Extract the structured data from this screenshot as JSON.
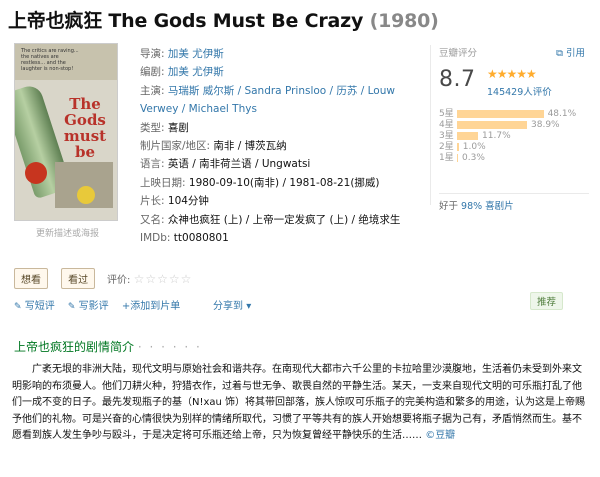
{
  "title": {
    "main": "上帝也疯狂 The Gods Must Be Crazy",
    "year": "(1980)"
  },
  "poster": {
    "tagline": "The critics are raving... the natives are restless... and the laughter is non-stop!",
    "title_text": "The Gods must be crazy",
    "more_desc": "更新描述或海报"
  },
  "info": {
    "director_label": "导演:",
    "director": "加美 尤伊斯",
    "writer_label": "编剧:",
    "writer": "加美 尤伊斯",
    "cast_label": "主演:",
    "cast_line1": "马瑞斯 威尔斯 / Sandra Prinsloo / 历苏 / Louw",
    "cast_line2": "Verwey / Michael Thys",
    "genre_label": "类型:",
    "genre": "喜剧",
    "country_label": "制片国家/地区:",
    "country": "南非 / 博茨瓦纳",
    "language_label": "语言:",
    "language": "英语 / 南非荷兰语 / Ungwatsi",
    "release_label": "上映日期:",
    "release": "1980-09-10(南非) / 1981-08-21(挪威)",
    "runtime_label": "片长:",
    "runtime": "104分钟",
    "aka_label": "又名:",
    "aka": "众神也疯狂 (上) / 上帝一定发疯了 (上) / 绝境求生",
    "imdb_label": "IMDb:",
    "imdb": "tt0080801"
  },
  "rating": {
    "header": "豆瓣评分",
    "cite": "引用",
    "score": "8.7",
    "stars": "★★★★★",
    "votes": "145429人评价",
    "distribution": [
      {
        "label": "5星",
        "percent": 48.1,
        "text": "48.1%"
      },
      {
        "label": "4星",
        "percent": 38.9,
        "text": "38.9%"
      },
      {
        "label": "3星",
        "percent": 11.7,
        "text": "11.7%"
      },
      {
        "label": "2星",
        "percent": 1.0,
        "text": "1.0%"
      },
      {
        "label": "1星",
        "percent": 0.3,
        "text": "0.3%"
      }
    ],
    "better_prefix": "好于",
    "better_value": "98% 喜剧片"
  },
  "actions": {
    "want": "想看",
    "watched": "看过",
    "eval_label": "评价:",
    "eval_stars": "☆☆☆☆☆"
  },
  "links": {
    "short_review": "写短评",
    "review": "写影评",
    "add_list": "+添加到片单",
    "share": "分享到",
    "recommend": "推荐"
  },
  "summary": {
    "title": "上帝也疯狂的剧情简介",
    "dots": "· · · · · ·",
    "text": "广袤无垠的非洲大陆，现代文明与原始社会和谐共存。在南现代大都市六千公里的卡拉哈里沙漠腹地，生活着仍未受到外来文明影响的布须曼人。他们刀耕火种，狩猎衣作，过着与世无争、歌畏自然的平静生活。某天，一支来自现代文明的可乐瓶打乱了他们一成不变的日子。最先发现瓶子的基（N!xau 饰）将其带回部落，族人惊叹可乐瓶子的完美构造和繁多的用途，认为这是上帝赐予他们的礼物。可是兴奋的心情很快为别样的情绪所取代，习惯了平等共有的族人开始想要将瓶子据为己有，矛盾悄然而生。基不愿看到族人发生争吵与殴斗，于是决定将可乐瓶还给上帝，只为恢复曾经平静快乐的生活……",
    "source": "©豆瓣"
  },
  "colors": {
    "link": "#3377aa",
    "green": "#007722",
    "star": "#ffac2d",
    "bar": "#ffd596"
  }
}
